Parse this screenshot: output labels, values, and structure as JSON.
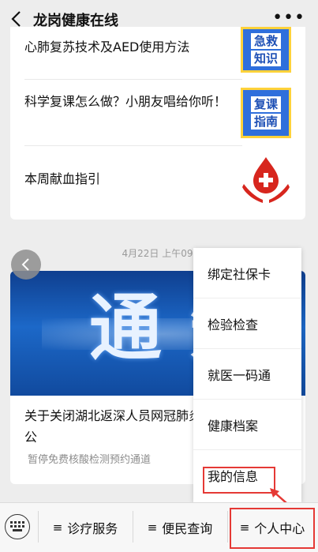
{
  "header": {
    "title": "龙岗健康在线",
    "back_icon": "back-arrow-icon",
    "more_icon": "more-icon"
  },
  "articles": [
    {
      "title": "心肺复苏技术及AED使用方法",
      "thumb_lines": [
        "急救",
        "知识"
      ]
    },
    {
      "title": "科学复课怎么做？小朋友唱给你听！",
      "thumb_lines": [
        "复课",
        "指南"
      ]
    },
    {
      "title": "本周献血指引"
    }
  ],
  "message": {
    "timestamp": "4月22日 上午09:",
    "banner_text": "通知",
    "title": "关于关闭湖北返深人员网冠肺炎核酸检测通道的公",
    "subtitle": "暂停免费核酸检测预约通道"
  },
  "popup_menu": {
    "items": [
      "绑定社保卡",
      "检验检查",
      "就医一码通",
      "健康档案",
      "我的信息"
    ]
  },
  "bottom_menu": {
    "tabs": [
      "诊疗服务",
      "便民查询",
      "个人中心"
    ],
    "menu_glyph": "≡"
  },
  "colors": {
    "highlight": "#e53935",
    "blood_red": "#d7261e",
    "banner_blue": "#1c68c8"
  }
}
